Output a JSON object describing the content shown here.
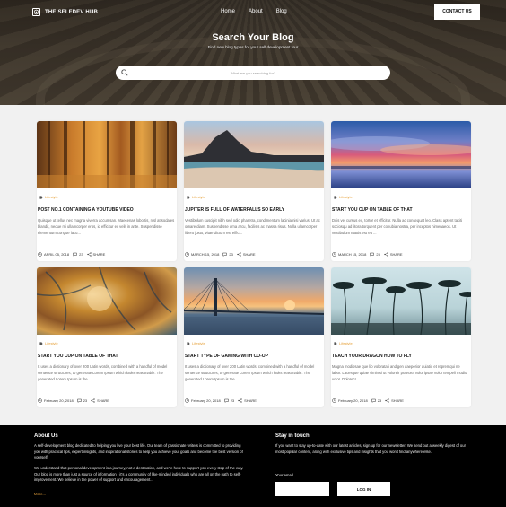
{
  "header": {
    "brand_name": "THE SELFDEV HUB",
    "nav": [
      {
        "label": "Home"
      },
      {
        "label": "About"
      },
      {
        "label": "Blog"
      }
    ],
    "contact_label": "CONTACT US"
  },
  "hero": {
    "title": "Search Your Blog",
    "subtitle": "Find new blog types for your self development tour",
    "search_placeholder": "What are you searching for?",
    "search_value": ""
  },
  "posts": [
    {
      "image": "forest",
      "category": "Lifestyle",
      "title": "POST NO.1 CONTAINING A YOUTUBE VIDEO",
      "excerpt": "Quisque ut tellus nec magna viverra accumsan. Maecenas lobortis, nisl at sodales blandit, neque mi ullamcorper eros, id efficitur ex velit in ante. Suspendisse elementum congue lacu...",
      "date": "APRIL 05, 2018",
      "comments": "23",
      "share_label": "SHARE"
    },
    {
      "image": "beach",
      "category": "Lifestyle",
      "title": "JUPITER IS FULL OF WATERFALLS SO EARLY",
      "excerpt": "Vestibulum suscipit nibh sed odio pharetra, condimentum lacinia nisi varius. Ut ac ornare diam. Suspendisse urna arcu, facilisis ac massa risus. Nulla ullamcorper libero justo, vitae dictum est effic...",
      "date": "MARCH 15, 2018",
      "comments": "23",
      "share_label": "SHARE"
    },
    {
      "image": "sky",
      "category": "Lifestyle",
      "title": "START YOU CUP ON TABLE OF THAT",
      "excerpt": "Duis vel cursus ex, tortor et efficitur. Nulla ac consequat leo. Class aptent taciti sociosqu ad litora torquent per conubia nostra, per inceptos himenaeos. Ut vestibulum mattis est eu ...",
      "date": "MARCH 15, 2018",
      "comments": "23",
      "share_label": "SHARE"
    },
    {
      "image": "bark",
      "category": "Lifestyle",
      "title": "START YOU CUP ON TABLE OF THAT",
      "excerpt": "It uses a dictionary of over 200 Latin words, combined with a handful of model sentence structures, to generate Lorem Ipsum which looks reasonable. The generated Lorem Ipsum is the...",
      "date": "February 20, 2018",
      "comments": "23",
      "share_label": "SHARE"
    },
    {
      "image": "bridge",
      "category": "Lifestyle",
      "title": "START TYPE OF GAMING WITH CO-OP",
      "excerpt": "It uses a dictionary of over 200 Latin words, combined with a handful of model sentence structures, to generate Lorem Ipsum which looks reasonable. The generated Lorem Ipsum is the...",
      "date": "February 20, 2018",
      "comments": "23",
      "share_label": "SHARE"
    },
    {
      "image": "palms",
      "category": "Lifestyle",
      "title": "TEACH YOUR DRAGON HOW TO FLY",
      "excerpt": "Magna modipsae que lib voloratati andigen daeperior quiatio et repremqui ne labor. Lacesque quiae siminisi ut voloreir praecea volut ipsae volor tempeli modio volor. Dolorecr ...",
      "date": "February 20, 2018",
      "comments": "23",
      "share_label": "SHARE"
    }
  ],
  "footer": {
    "about_heading": "About Us",
    "about_p1": "A self-development blog dedicated to helping you live your best life. Our team of passionate writers is committed to providing you with practical tips, expert insights, and inspirational stories to help you achieve your goals and become the best version of yourself.",
    "about_p2": "We understand that personal development is a journey, not a destination, and we're here to support you every step of the way. Our blog is more than just a source of information - it's a community of like-minded individuals who are all on the path to self-improvement. We believe in the power of support and encouragement...",
    "more_label": "More...",
    "stay_heading": "Stay in touch",
    "stay_text": "If you want to stay up-to-date with our latest articles, sign up for our newsletter. We send out a weekly digest of our most popular content, along with exclusive tips and insights that you won't find anywhere else.",
    "email_label": "Your email",
    "email_value": "",
    "login_label": "LOG IN"
  },
  "colors": {
    "accent": "#e6a23c",
    "footer_bg": "#000000",
    "page_bg": "#f1f1f1"
  }
}
